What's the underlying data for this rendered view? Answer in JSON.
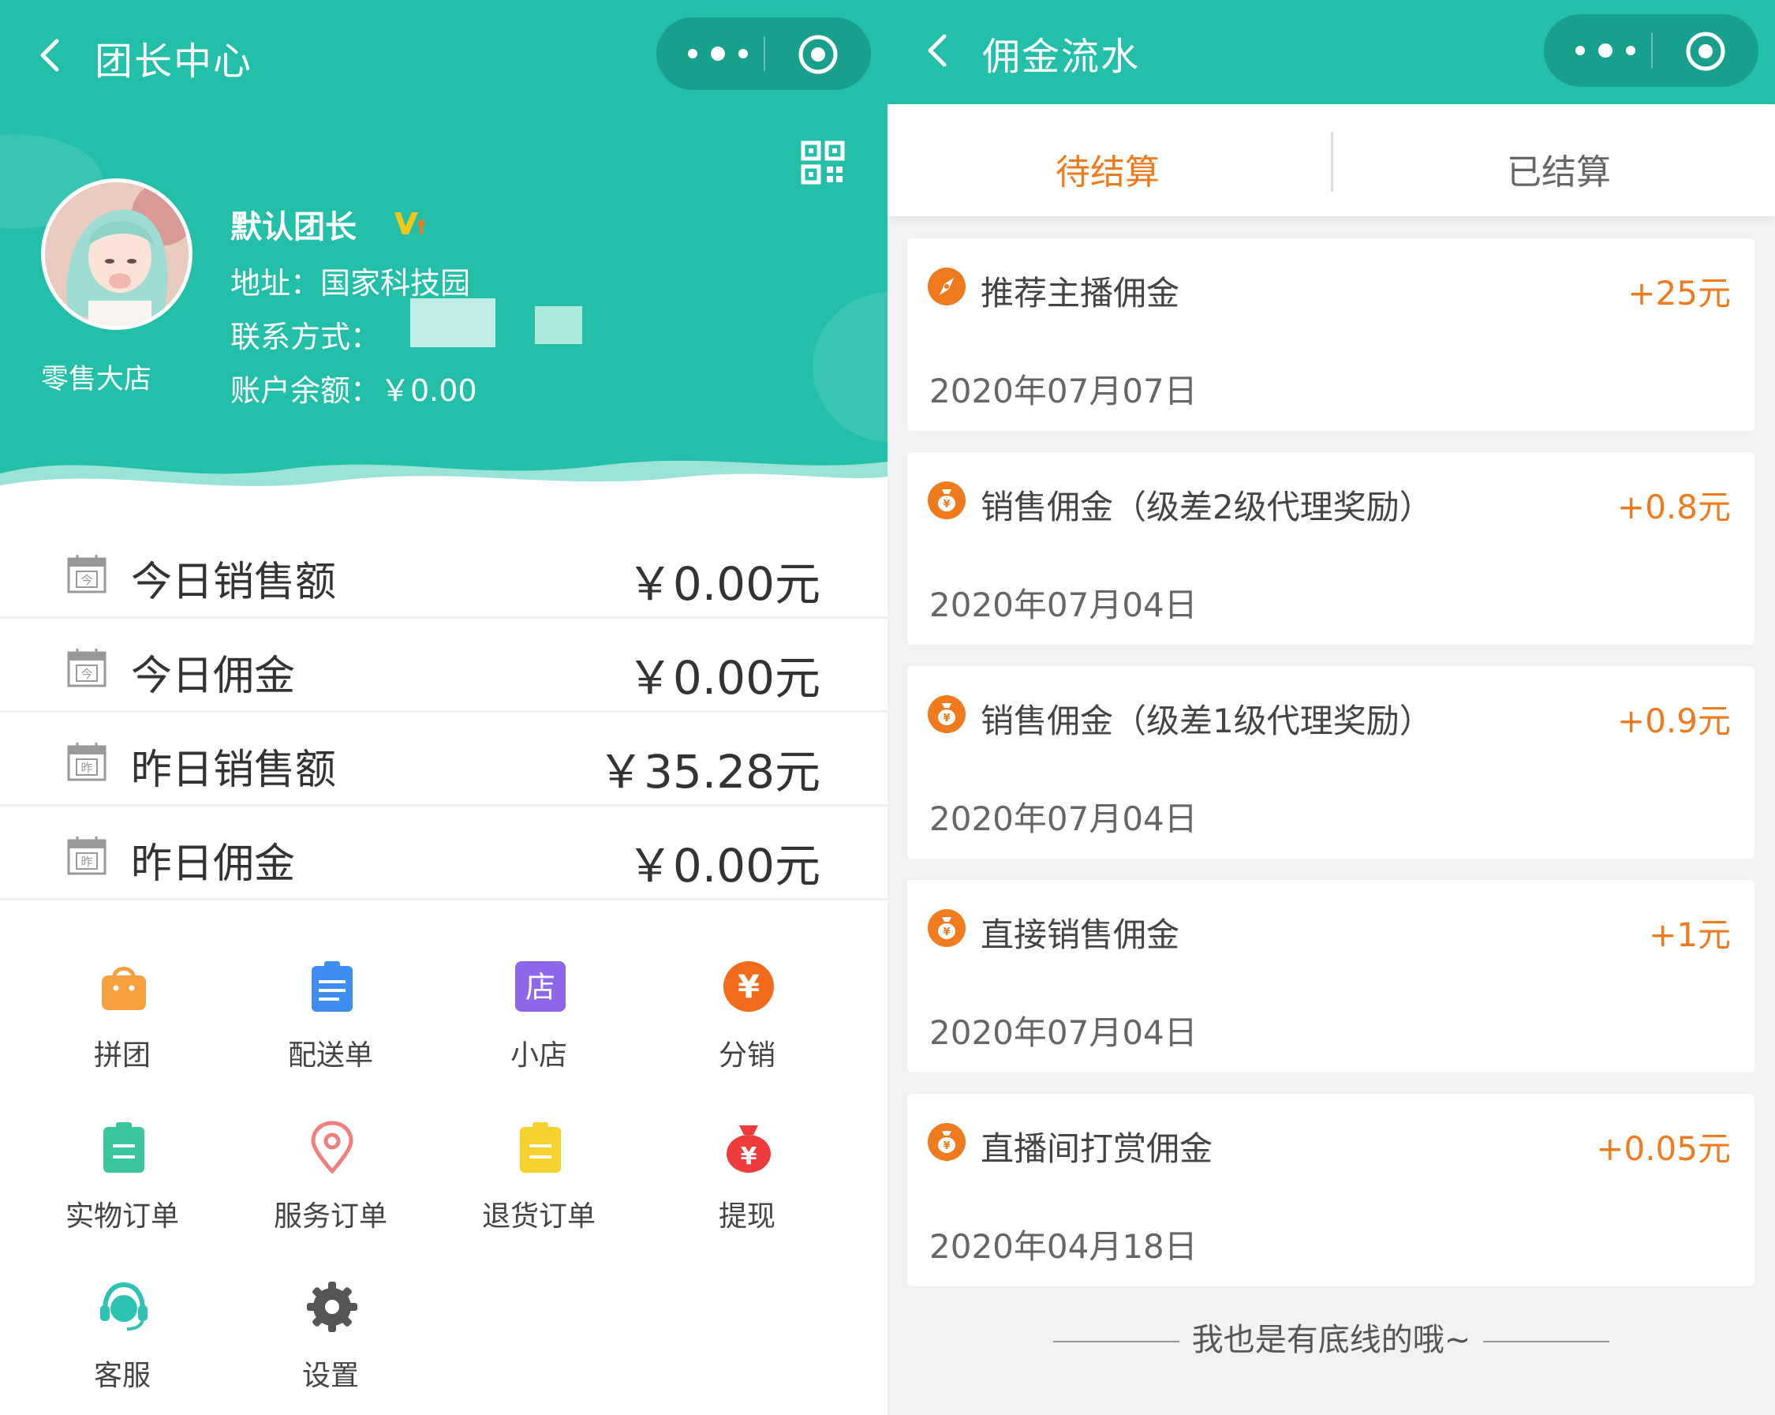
{
  "colors": {
    "primary": "#23bfa8",
    "accent": "#f07b1f",
    "active_tab": "#f07b1f"
  },
  "left": {
    "nav": {
      "title": "团长中心",
      "back_icon": "chevron-left-icon",
      "more_icon": "more-dots-icon",
      "record_icon": "record-icon"
    },
    "profile": {
      "shop_name": "零售大店",
      "leader_name": "默认团长",
      "address": "地址：国家科技园",
      "contact": "联系方式：",
      "balance": "账户余额：￥0.00"
    },
    "stats": [
      {
        "label": "今日销售额",
        "value": "￥0.00元",
        "icon_char": "今"
      },
      {
        "label": "今日佣金",
        "value": "￥0.00元",
        "icon_char": "今"
      },
      {
        "label": "昨日销售额",
        "value": "￥35.28元",
        "icon_char": "昨"
      },
      {
        "label": "昨日佣金",
        "value": "￥0.00元",
        "icon_char": "昨"
      }
    ],
    "menu": [
      {
        "label": "拼团",
        "icon": "shopping-bag-icon",
        "color": "#f7a040"
      },
      {
        "label": "配送单",
        "icon": "clipboard-list-icon",
        "color": "#3d8ef0"
      },
      {
        "label": "小店",
        "icon": "store-icon",
        "color": "#8e67e8",
        "icon_text": "店"
      },
      {
        "label": "分销",
        "icon": "yen-coin-icon",
        "color": "#f26b1d",
        "icon_text": "¥"
      },
      {
        "label": "实物订单",
        "icon": "clipboard-icon",
        "color": "#3cc6a0"
      },
      {
        "label": "服务订单",
        "icon": "location-pin-icon",
        "color": "#f17f7f"
      },
      {
        "label": "退货订单",
        "icon": "clipboard-return-icon",
        "color": "#f5d22d"
      },
      {
        "label": "提现",
        "icon": "money-bag-icon",
        "color": "#ee3b3b",
        "icon_text": "¥"
      },
      {
        "label": "客服",
        "icon": "headset-icon",
        "color": "#2cc3b3"
      },
      {
        "label": "设置",
        "icon": "gear-icon",
        "color": "#555555"
      }
    ]
  },
  "right": {
    "nav": {
      "title": "佣金流水"
    },
    "tabs": [
      {
        "label": "待结算",
        "active": true
      },
      {
        "label": "已结算",
        "active": false
      }
    ],
    "records": [
      {
        "title": "推荐主播佣金",
        "amount": "+25元",
        "date": "2020年07月07日",
        "icon": "compass-icon"
      },
      {
        "title": "销售佣金（级差2级代理奖励）",
        "amount": "+0.8元",
        "date": "2020年07月04日",
        "icon": "money-bag-icon"
      },
      {
        "title": "销售佣金（级差1级代理奖励）",
        "amount": "+0.9元",
        "date": "2020年07月04日",
        "icon": "money-bag-icon"
      },
      {
        "title": "直接销售佣金",
        "amount": "+1元",
        "date": "2020年07月04日",
        "icon": "money-bag-icon"
      },
      {
        "title": "直播间打赏佣金",
        "amount": "+0.05元",
        "date": "2020年04月18日",
        "icon": "money-bag-icon"
      }
    ],
    "footer": "我也是有底线的哦~"
  }
}
